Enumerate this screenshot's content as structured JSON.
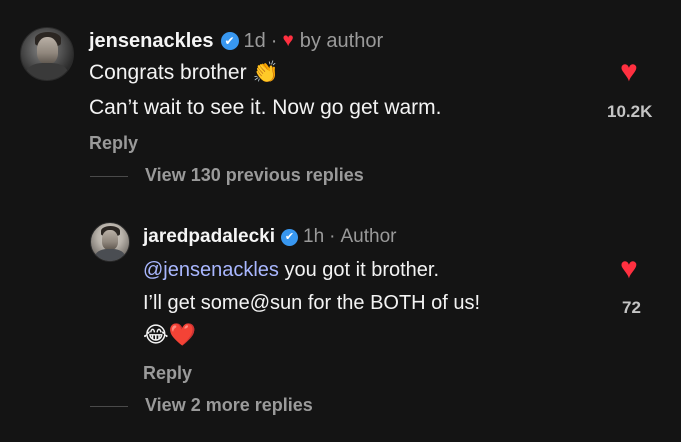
{
  "comment": {
    "username": "jensenackles",
    "verified_glyph": "✔",
    "time": "1d",
    "separator": "·",
    "liked_by_author_icon": "♥",
    "liked_by_author_label": "by author",
    "lines": [
      "Congrats brother",
      "Can’t wait to see it. Now go get warm."
    ],
    "emoji": "👏",
    "reply_label": "Reply",
    "like_icon": "♥",
    "like_count": "10.2K"
  },
  "thread": {
    "view_previous_label": "View 130 previous replies",
    "view_more_label": "View 2 more replies"
  },
  "reply": {
    "username": "jaredpadalecki",
    "verified_glyph": "✔",
    "time": "1h",
    "separator": "·",
    "role": "Author",
    "mention": "@jensenackles",
    "line1_rest": " you got it brother.",
    "line2": "I’ll get some@sun for the BOTH of us!",
    "line3_emojis": "😂❤️",
    "reply_label": "Reply",
    "like_icon": "♥",
    "like_count": "72"
  },
  "colors": {
    "background": "#141414",
    "like_red": "#ff3040",
    "verified_blue": "#3897f0",
    "mention": "#a9b7ff",
    "muted": "#9a9a9a"
  }
}
